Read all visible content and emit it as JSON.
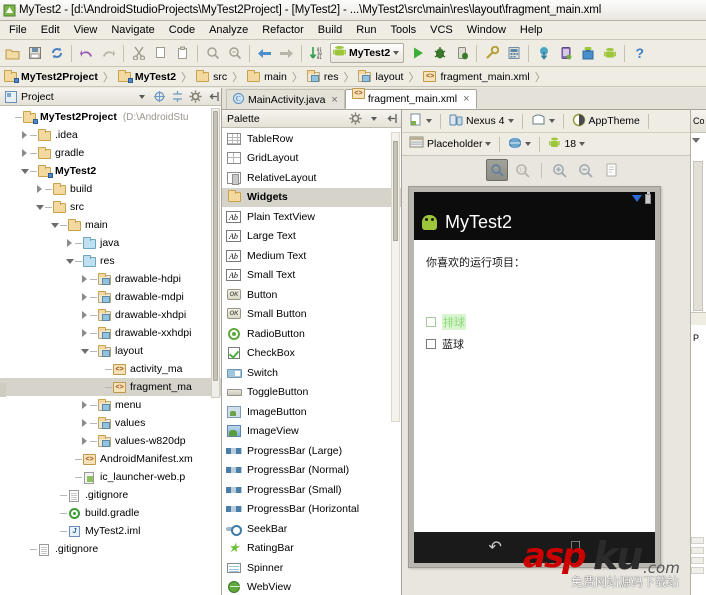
{
  "window": {
    "title": "MyTest2 - [d:\\AndroidStudioProjects\\MyTest2Project] - [MyTest2] - ...\\MyTest2\\src\\main\\res\\layout\\fragment_main.xml",
    "icon": "android-studio-icon"
  },
  "menubar": {
    "items": [
      "File",
      "Edit",
      "View",
      "Navigate",
      "Code",
      "Analyze",
      "Refactor",
      "Build",
      "Run",
      "Tools",
      "VCS",
      "Window",
      "Help"
    ]
  },
  "toolbar": {
    "buttons": [
      {
        "name": "open-icon",
        "glyph": "folder"
      },
      {
        "name": "save-all-icon",
        "glyph": "save"
      },
      {
        "name": "sync-icon",
        "glyph": "sync"
      },
      {
        "name": "undo-icon",
        "glyph": "undo"
      },
      {
        "name": "redo-icon",
        "glyph": "redo"
      },
      {
        "name": "cut-icon",
        "glyph": "cut"
      },
      {
        "name": "copy-icon",
        "glyph": "copy"
      },
      {
        "name": "paste-icon",
        "glyph": "paste"
      },
      {
        "name": "find-icon",
        "glyph": "find"
      },
      {
        "name": "replace-icon",
        "glyph": "replace"
      },
      {
        "name": "back-icon",
        "glyph": "back"
      },
      {
        "name": "forward-icon",
        "glyph": "forward"
      },
      {
        "name": "sort-icon",
        "glyph": "sort"
      }
    ],
    "run_config": "MyTest2",
    "right_buttons": [
      {
        "name": "run-icon",
        "glyph": "run"
      },
      {
        "name": "debug-icon",
        "glyph": "debug"
      },
      {
        "name": "attach-debugger-icon",
        "glyph": "attach"
      },
      {
        "name": "sdk-manager-icon",
        "glyph": "sdk"
      },
      {
        "name": "avd-manager-icon",
        "glyph": "avd"
      },
      {
        "name": "sync-gradle-icon",
        "glyph": "gradle-sync"
      },
      {
        "name": "device-monitor-icon",
        "glyph": "monitor"
      },
      {
        "name": "android-sdk-icon",
        "glyph": "android-sdk"
      },
      {
        "name": "android-icon",
        "glyph": "android"
      },
      {
        "name": "help-icon",
        "glyph": "?"
      }
    ]
  },
  "breadcrumb": {
    "items": [
      {
        "label": "MyTest2Project",
        "icon": "module-folder-icon",
        "bold": true
      },
      {
        "label": "MyTest2",
        "icon": "module-folder-icon",
        "bold": true
      },
      {
        "label": "src",
        "icon": "folder-icon",
        "bold": false
      },
      {
        "label": "main",
        "icon": "folder-icon",
        "bold": false
      },
      {
        "label": "res",
        "icon": "res-folder-icon",
        "bold": false
      },
      {
        "label": "layout",
        "icon": "res-folder-icon",
        "bold": false
      },
      {
        "label": "fragment_main.xml",
        "icon": "xml-file-icon",
        "bold": false
      }
    ]
  },
  "project_panel": {
    "title": "Project",
    "header_icons": [
      "target-icon",
      "collapse-all-icon",
      "gear-icon",
      "hide-icon"
    ],
    "tree": [
      {
        "label": "MyTest2Project",
        "path": "(D:\\AndroidStu",
        "indent": 0,
        "arrow": "none",
        "icon": "module-folder",
        "bold": true
      },
      {
        "label": ".idea",
        "indent": 1,
        "arrow": "closed",
        "icon": "folder",
        "bold": false
      },
      {
        "label": "gradle",
        "indent": 1,
        "arrow": "closed",
        "icon": "folder",
        "bold": false
      },
      {
        "label": "MyTest2",
        "indent": 1,
        "arrow": "open",
        "icon": "module-folder",
        "bold": true
      },
      {
        "label": "build",
        "indent": 2,
        "arrow": "closed",
        "icon": "folder",
        "bold": false
      },
      {
        "label": "src",
        "indent": 2,
        "arrow": "open",
        "icon": "folder",
        "bold": false
      },
      {
        "label": "main",
        "indent": 3,
        "arrow": "open",
        "icon": "folder",
        "bold": false
      },
      {
        "label": "java",
        "indent": 4,
        "arrow": "closed",
        "icon": "folder-blue",
        "bold": false
      },
      {
        "label": "res",
        "indent": 4,
        "arrow": "open",
        "icon": "folder-blue",
        "bold": false
      },
      {
        "label": "drawable-hdpi",
        "indent": 5,
        "arrow": "closed",
        "icon": "res-folder",
        "bold": false
      },
      {
        "label": "drawable-mdpi",
        "indent": 5,
        "arrow": "closed",
        "icon": "res-folder",
        "bold": false
      },
      {
        "label": "drawable-xhdpi",
        "indent": 5,
        "arrow": "closed",
        "icon": "res-folder",
        "bold": false
      },
      {
        "label": "drawable-xxhdpi",
        "indent": 5,
        "arrow": "closed",
        "icon": "res-folder",
        "bold": false
      },
      {
        "label": "layout",
        "indent": 5,
        "arrow": "open",
        "icon": "res-folder",
        "bold": false
      },
      {
        "label": "activity_ma",
        "indent": 6,
        "arrow": "none",
        "icon": "xml-file",
        "bold": false
      },
      {
        "label": "fragment_ma",
        "indent": 6,
        "arrow": "none",
        "icon": "xml-file",
        "bold": false,
        "selected": true
      },
      {
        "label": "menu",
        "indent": 5,
        "arrow": "closed",
        "icon": "res-folder",
        "bold": false
      },
      {
        "label": "values",
        "indent": 5,
        "arrow": "closed",
        "icon": "res-folder",
        "bold": false
      },
      {
        "label": "values-w820dp",
        "indent": 5,
        "arrow": "closed",
        "icon": "res-folder",
        "bold": false
      },
      {
        "label": "AndroidManifest.xm",
        "indent": 4,
        "arrow": "none",
        "icon": "xml-file",
        "bold": false
      },
      {
        "label": "ic_launcher-web.p",
        "indent": 4,
        "arrow": "none",
        "icon": "png-file",
        "bold": false
      },
      {
        "label": ".gitignore",
        "indent": 3,
        "arrow": "none",
        "icon": "text-file",
        "bold": false
      },
      {
        "label": "build.gradle",
        "indent": 3,
        "arrow": "none",
        "icon": "gradle-file",
        "bold": false
      },
      {
        "label": "MyTest2.iml",
        "indent": 3,
        "arrow": "none",
        "icon": "iml-file",
        "bold": false
      },
      {
        "label": ".gitignore",
        "indent": 1,
        "arrow": "none",
        "icon": "text-file",
        "bold": false
      }
    ]
  },
  "editor_tabs": [
    {
      "label": "MainActivity.java",
      "icon": "java-class-icon",
      "active": false,
      "close": "×"
    },
    {
      "label": "fragment_main.xml",
      "icon": "xml-file-icon",
      "active": true,
      "close": "×"
    }
  ],
  "palette_panel": {
    "title": "Palette",
    "header_icons": [
      "gear-icon",
      "hide-icon"
    ],
    "items": [
      {
        "label": "TableRow",
        "icon": "table-row-icon",
        "group": false
      },
      {
        "label": "GridLayout",
        "icon": "grid-layout-icon",
        "group": false
      },
      {
        "label": "RelativeLayout",
        "icon": "relative-layout-icon",
        "group": false
      },
      {
        "label": "Widgets",
        "icon": "folder-icon",
        "group": true
      },
      {
        "label": "Plain TextView",
        "icon": "textview-icon",
        "group": false
      },
      {
        "label": "Large Text",
        "icon": "textview-icon",
        "group": false
      },
      {
        "label": "Medium Text",
        "icon": "textview-icon",
        "group": false
      },
      {
        "label": "Small Text",
        "icon": "textview-icon",
        "group": false
      },
      {
        "label": "Button",
        "icon": "button-icon",
        "group": false
      },
      {
        "label": "Small Button",
        "icon": "button-icon",
        "group": false
      },
      {
        "label": "RadioButton",
        "icon": "radio-button-icon",
        "group": false
      },
      {
        "label": "CheckBox",
        "icon": "checkbox-icon",
        "group": false
      },
      {
        "label": "Switch",
        "icon": "switch-icon",
        "group": false
      },
      {
        "label": "ToggleButton",
        "icon": "toggle-button-icon",
        "group": false
      },
      {
        "label": "ImageButton",
        "icon": "image-button-icon",
        "group": false
      },
      {
        "label": "ImageView",
        "icon": "image-view-icon",
        "group": false
      },
      {
        "label": "ProgressBar (Large)",
        "icon": "progress-bar-icon",
        "group": false
      },
      {
        "label": "ProgressBar (Normal)",
        "icon": "progress-bar-icon",
        "group": false
      },
      {
        "label": "ProgressBar (Small)",
        "icon": "progress-bar-icon",
        "group": false
      },
      {
        "label": "ProgressBar (Horizontal",
        "icon": "progress-bar-icon",
        "group": false
      },
      {
        "label": "SeekBar",
        "icon": "seek-bar-icon",
        "group": false
      },
      {
        "label": "RatingBar",
        "icon": "rating-bar-icon",
        "group": false
      },
      {
        "label": "Spinner",
        "icon": "spinner-icon",
        "group": false
      },
      {
        "label": "WebView",
        "icon": "web-view-icon",
        "group": false
      }
    ]
  },
  "design_toolbar": {
    "row1": [
      {
        "name": "layout-variation-chip",
        "label": "",
        "icon": "layout-variation-icon"
      },
      {
        "name": "device-chip",
        "label": "Nexus 4",
        "icon": "device-icon"
      },
      {
        "name": "orientation-chip",
        "label": "",
        "icon": "orientation-icon"
      },
      {
        "name": "theme-chip",
        "label": "AppTheme",
        "icon": "theme-icon"
      }
    ],
    "row2": [
      {
        "name": "activity-chip",
        "label": "Placeholder",
        "icon": "activity-icon"
      },
      {
        "name": "locale-chip",
        "label": "",
        "icon": "globe-icon"
      },
      {
        "name": "api-chip",
        "label": "18",
        "icon": "android-icon"
      }
    ],
    "zoom_buttons": [
      {
        "name": "zoom-fit-button",
        "icon": "zoom-fit-icon",
        "active": true
      },
      {
        "name": "zoom-actual-button",
        "icon": "zoom-actual-icon",
        "active": false
      },
      {
        "name": "zoom-in-button",
        "icon": "zoom-in-icon",
        "active": false
      },
      {
        "name": "zoom-out-button",
        "icon": "zoom-out-icon",
        "active": false
      },
      {
        "name": "refresh-render-button",
        "icon": "document-icon",
        "active": false
      }
    ]
  },
  "preview": {
    "app_title": "MyTest2",
    "app_icon": "android-robot-icon",
    "prompt_text": "你喜欢的运行项目：",
    "checkboxes": [
      {
        "label": "排球",
        "checked": false,
        "highlighted": true
      },
      {
        "label": "蓝球",
        "checked": false,
        "highlighted": false
      }
    ],
    "nav_buttons": [
      "back-nav-icon",
      "home-nav-icon"
    ],
    "status_icons": [
      "wifi-icon",
      "battery-icon"
    ]
  },
  "right_stub": {
    "component_tree_label": "Co",
    "properties_label": "P"
  },
  "watermark": {
    "brand_red": "asp",
    "brand_dark": "ku",
    "domain": ".com",
    "tagline": "免费网站源码下载站",
    "color_red": "#cc0000"
  }
}
